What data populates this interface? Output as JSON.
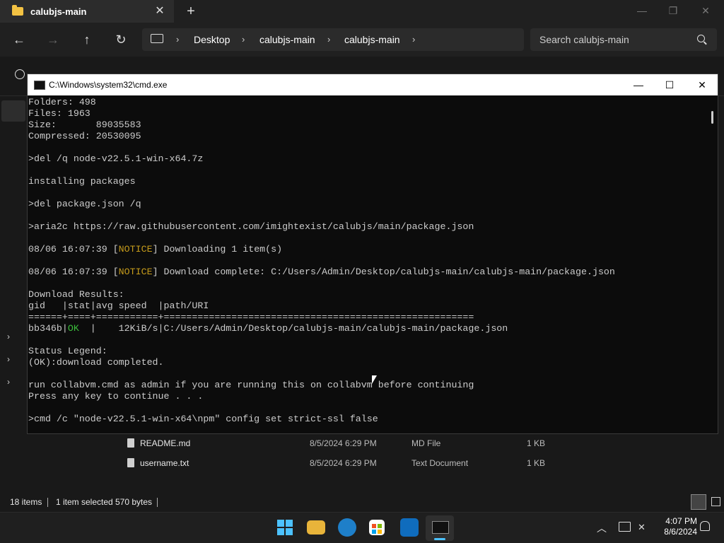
{
  "explorer": {
    "tab_title": "calubjs-main",
    "tab_close": "✕",
    "new_tab": "+",
    "window_min": "—",
    "window_restore": "❐",
    "window_close": "✕",
    "nav": {
      "back": "←",
      "forward": "→",
      "up": "↑",
      "refresh": "↻"
    },
    "breadcrumbs": [
      "Desktop",
      "calubjs-main",
      "calubjs-main"
    ],
    "breadcrumb_sep": "›",
    "search_placeholder": "Search calubjs-main",
    "files": [
      {
        "name": "README.md",
        "date": "8/5/2024 6:29 PM",
        "type": "MD File",
        "size": "1 KB"
      },
      {
        "name": "username.txt",
        "date": "8/5/2024 6:29 PM",
        "type": "Text Document",
        "size": "1 KB"
      }
    ],
    "status": {
      "items": "18 items",
      "selected": "1 item selected",
      "size": "570 bytes"
    },
    "side_caret": "›"
  },
  "cmd": {
    "title": "C:\\Windows\\system32\\cmd.exe",
    "minimize": "—",
    "maximize": "☐",
    "close": "✕",
    "lines": {
      "l1": "Folders: 498",
      "l2": "Files: 1963",
      "l3": "Size:       89035583",
      "l4": "Compressed: 20530095",
      "l5": ">del /q node-v22.5.1-win-x64.7z",
      "l6": "installing packages",
      "l7": ">del package.json /q",
      "l8": ">aria2c https://raw.githubusercontent.com/imightexist/calubjs/main/package.json",
      "l9_a": "08/06 16:07:39 [",
      "l9_b": "NOTICE",
      "l9_c": "] Downloading 1 item(s)",
      "l10_a": "08/06 16:07:39 [",
      "l10_b": "NOTICE",
      "l10_c": "] Download complete: C:/Users/Admin/Desktop/calubjs-main/calubjs-main/package.json",
      "l11": "Download Results:",
      "l12": "gid   |stat|avg speed  |path/URI",
      "l13": "======+====+===========+=======================================================",
      "l14_a": "bb346b|",
      "l14_b": "OK",
      "l14_c": "  |    12KiB/s|C:/Users/Admin/Desktop/calubjs-main/calubjs-main/package.json",
      "l15": "Status Legend:",
      "l16": "(OK):download completed.",
      "l17": "run collabvm.cmd as admin if you are running this on collabvm before continuing",
      "l18": "Press any key to continue . . .",
      "l19": ">cmd /c \"node-v22.5.1-win-x64\\npm\" config set strict-ssl false"
    }
  },
  "taskbar": {
    "time": "4:07 PM",
    "date": "8/6/2024",
    "tray_chevron": "︿"
  }
}
